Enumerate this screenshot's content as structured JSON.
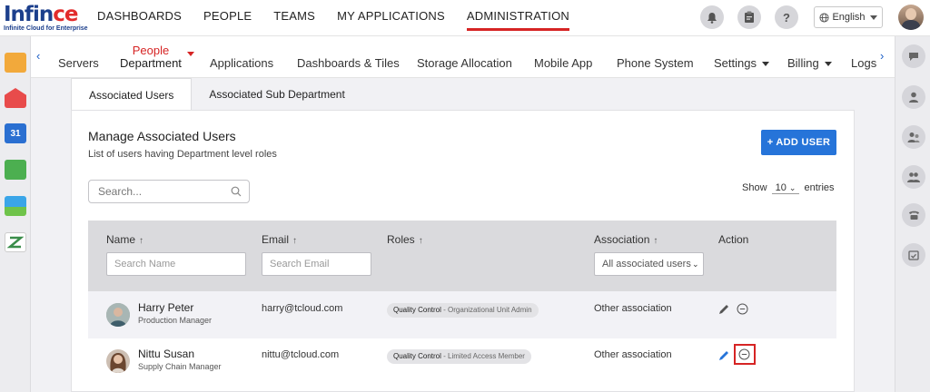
{
  "logo": {
    "text_main_a": "Infin",
    "text_main_b": "ce",
    "tagline": "Infinite Cloud for Enterprise"
  },
  "top_nav": [
    "DASHBOARDS",
    "PEOPLE",
    "TEAMS",
    "MY APPLICATIONS",
    "ADMINISTRATION"
  ],
  "top_nav_active": "ADMINISTRATION",
  "language": "English",
  "sub_nav": {
    "items": [
      "Servers",
      "Applications",
      "Dashboards & Tiles",
      "Storage Allocation",
      "Mobile App",
      "Phone System",
      "Settings",
      "Billing",
      "Logs"
    ],
    "active_line1": "People",
    "active_line2": "Department"
  },
  "tabs": [
    "Associated Users",
    "Associated Sub Department"
  ],
  "panel": {
    "title": "Manage Associated Users",
    "subtitle": "List of users having Department level roles",
    "add_button": "+ ADD USER",
    "search_placeholder": "Search...",
    "show_label": "Show",
    "show_value": "10",
    "entries_label": "entries"
  },
  "table": {
    "headers": [
      "Name",
      "Email",
      "Roles",
      "Association",
      "Action"
    ],
    "filters": {
      "name": "Search Name",
      "email": "Search Email",
      "association": "All associated users"
    },
    "rows": [
      {
        "name": "Harry Peter",
        "title": "Production Manager",
        "email": "harry@tcloud.com",
        "role_main": "Quality Control",
        "role_detail": " - Organizational Unit Admin",
        "association": "Other association"
      },
      {
        "name": "Nittu Susan",
        "title": "Supply Chain Manager",
        "email": "nittu@tcloud.com",
        "role_main": "Quality Control",
        "role_detail": " - Limited Access Member",
        "association": "Other association"
      }
    ]
  },
  "colors": {
    "accent": "#2674d9",
    "active_red": "#d62424",
    "brand_blue": "#1c3f8c"
  },
  "icons": [
    "bell-icon",
    "clipboard-icon",
    "help-icon",
    "globe-icon",
    "chat-icon",
    "user-icon",
    "user-group-icon",
    "users-icon",
    "phone-icon",
    "calendar-check-icon",
    "pencil-icon",
    "minus-circle-icon"
  ]
}
